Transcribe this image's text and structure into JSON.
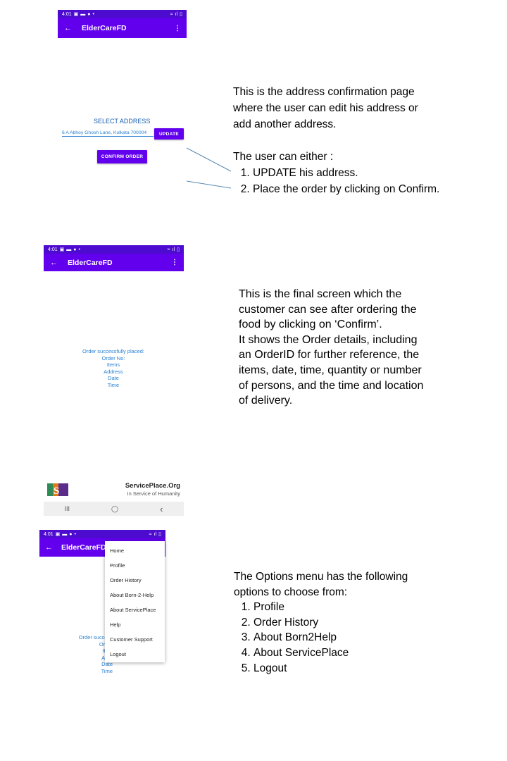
{
  "colors": {
    "primary": "#6200ee",
    "status_bar": "#4e0bd0",
    "link_blue": "#2a82d4"
  },
  "status_bar": {
    "time": "4:01",
    "left_icons": [
      "image-icon",
      "chat-icon",
      "circle-icon"
    ],
    "right_icons": [
      "wifi-icon",
      "signal-icon",
      "battery-icon"
    ]
  },
  "app": {
    "title": "ElderCareFD"
  },
  "screen1": {
    "heading": "SELECT ADDRESS",
    "address": "6 A Abhoy Ghosh Lane, Kolkata 700004",
    "update_label": "UPDATE",
    "confirm_label": "CONFIRM ORDER"
  },
  "desc1": {
    "line1": "This is the address confirmation page",
    "line2": "where the user can edit his address or",
    "line3": "add another address.",
    "line4": "The user can either :",
    "items": [
      "UPDATE his address.",
      "Place the order by clicking on Confirm."
    ]
  },
  "screen2": {
    "lines": [
      "Order successfully placed:",
      "Order No:",
      "Items",
      "Address",
      "Date",
      "Time"
    ]
  },
  "desc2": {
    "lines": [
      "This is the final screen which the",
      "customer can see after ordering the",
      "food by clicking on ‘Confirm’.",
      "It shows the Order details, including",
      "an OrderID for further reference, the",
      "items, date, time, quantity or number",
      "of persons, and the time and location",
      "of delivery."
    ]
  },
  "footer_brand": {
    "name": "ServicePlace.Org",
    "tagline": "In Service of Humanity",
    "nav_icons": [
      "recents-icon",
      "home-icon",
      "back-icon"
    ],
    "nav_glyphs": [
      "III",
      "◯",
      "‹"
    ]
  },
  "screen3": {
    "menu_items": [
      "Home",
      "Profile",
      "Order History",
      "About Born-2-Help",
      "About ServicePlace",
      "Help",
      "Customer Support",
      "Logout"
    ],
    "behind_lines": [
      "Order success",
      "Order",
      "Item",
      "Addr",
      "Date",
      "Time"
    ]
  },
  "desc3": {
    "line1": "The Options menu has the following",
    "line2": "options to choose from:",
    "items": [
      "Profile",
      "Order History",
      "About Born2Help",
      "About ServicePlace",
      "Logout"
    ]
  }
}
